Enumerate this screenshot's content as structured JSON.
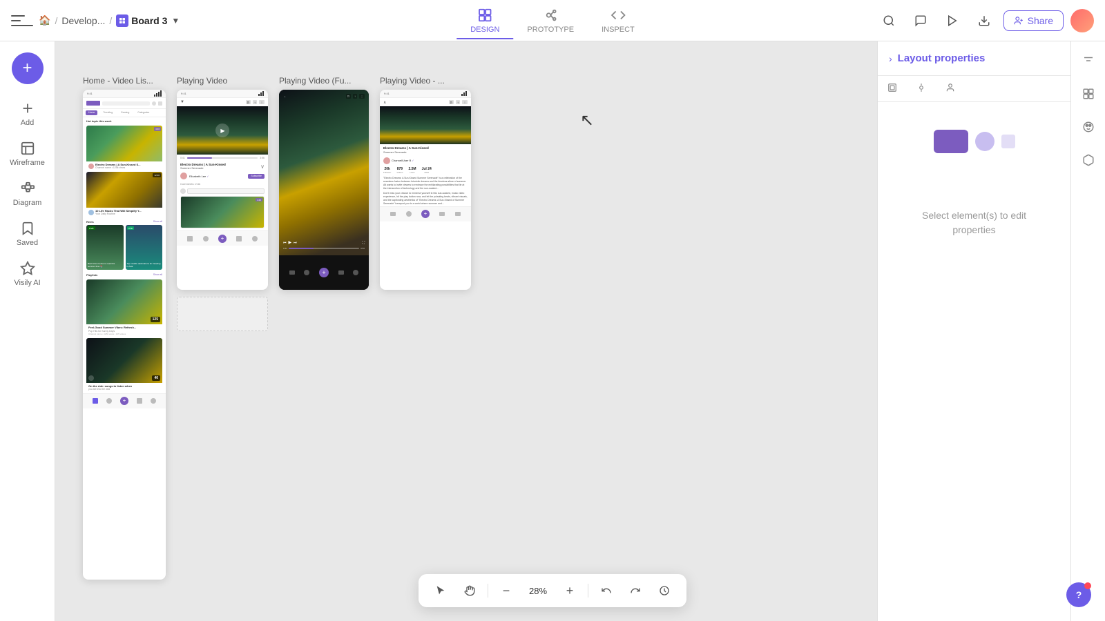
{
  "topbar": {
    "title": "Board 3",
    "breadcrumb_home": "🏠",
    "breadcrumb_project": "Develop...",
    "share_label": "Share",
    "design_label": "DESIGN",
    "prototype_label": "PROTOTYPE",
    "inspect_label": "INSPECT"
  },
  "sidebar": {
    "add_label": "+",
    "items": [
      {
        "id": "add",
        "label": "Add"
      },
      {
        "id": "wireframe",
        "label": "Wireframe"
      },
      {
        "id": "diagram",
        "label": "Diagram"
      },
      {
        "id": "saved",
        "label": "Saved"
      },
      {
        "id": "visily-ai",
        "label": "Visily AI"
      }
    ]
  },
  "frames": [
    {
      "label": "Home - Video Lis..."
    },
    {
      "label": "Playing Video"
    },
    {
      "label": "Playing Video (Fu..."
    },
    {
      "label": "Playing Video - ..."
    }
  ],
  "right_panel": {
    "title": "Layout properties",
    "select_hint": "Select element(s) to edit\nproperties"
  },
  "bottom_toolbar": {
    "zoom_level": "28%"
  },
  "help": {
    "label": "?"
  }
}
